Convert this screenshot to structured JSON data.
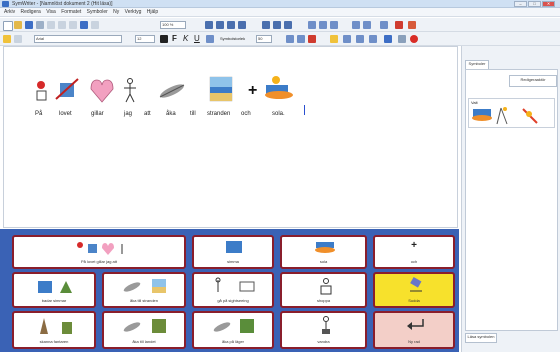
{
  "window": {
    "title": "SymWriter - [Namnlöst dokument 2 (Hit läsa)]",
    "controls": [
      "–",
      "□",
      "✕"
    ]
  },
  "menu": {
    "items": [
      "Arkiv",
      "Redigera",
      "Visa",
      "Formatet",
      "Symboler",
      "Ny",
      "Verktyg",
      "Hjälp"
    ]
  },
  "format_toolbar": {
    "font": "Arial",
    "font_size": "12",
    "bold": "F",
    "italic": "K",
    "underline": "U",
    "symbol_label": "Symbolstorlek",
    "symbol_size": "50"
  },
  "toolbar": {
    "zoom": "100 %"
  },
  "document": {
    "words": [
      "På",
      "lovet",
      "gillar",
      "jag",
      "att",
      "åka",
      "till",
      "stranden",
      "och",
      "sola."
    ],
    "plus": "+"
  },
  "panel": {
    "tab": "Symboler",
    "button": "Redigeraaktör",
    "list_header": "Valt",
    "bottom_tab": "Läsa symbolen"
  },
  "grid": {
    "cells": [
      {
        "label": "På lovet gillar jag att",
        "style": "white"
      },
      {
        "label": "simma",
        "style": "white"
      },
      {
        "label": "sola",
        "style": "white"
      },
      {
        "label": "och",
        "style": "white",
        "mark": "+"
      },
      {
        "label": "badar simmar",
        "style": "white"
      },
      {
        "label": "åka till stranden",
        "style": "white"
      },
      {
        "label": "gå på sightseeing",
        "style": "white"
      },
      {
        "label": "shoppa",
        "style": "white"
      },
      {
        "label": "Sudda",
        "style": "yellow"
      },
      {
        "label": "skanna fantaren",
        "style": "white"
      },
      {
        "label": "åka till landet",
        "style": "white"
      },
      {
        "label": "åka på läger",
        "style": "white"
      },
      {
        "label": "vandra",
        "style": "white"
      },
      {
        "label": "Ny rad",
        "style": "pink"
      }
    ]
  },
  "colors": {
    "grid_background": "#3a62b5",
    "cell_border": "#8a1e2c",
    "sudda": "#f7e12c",
    "nyrad": "#f3cfc8",
    "heart": "#f2a0c0"
  }
}
